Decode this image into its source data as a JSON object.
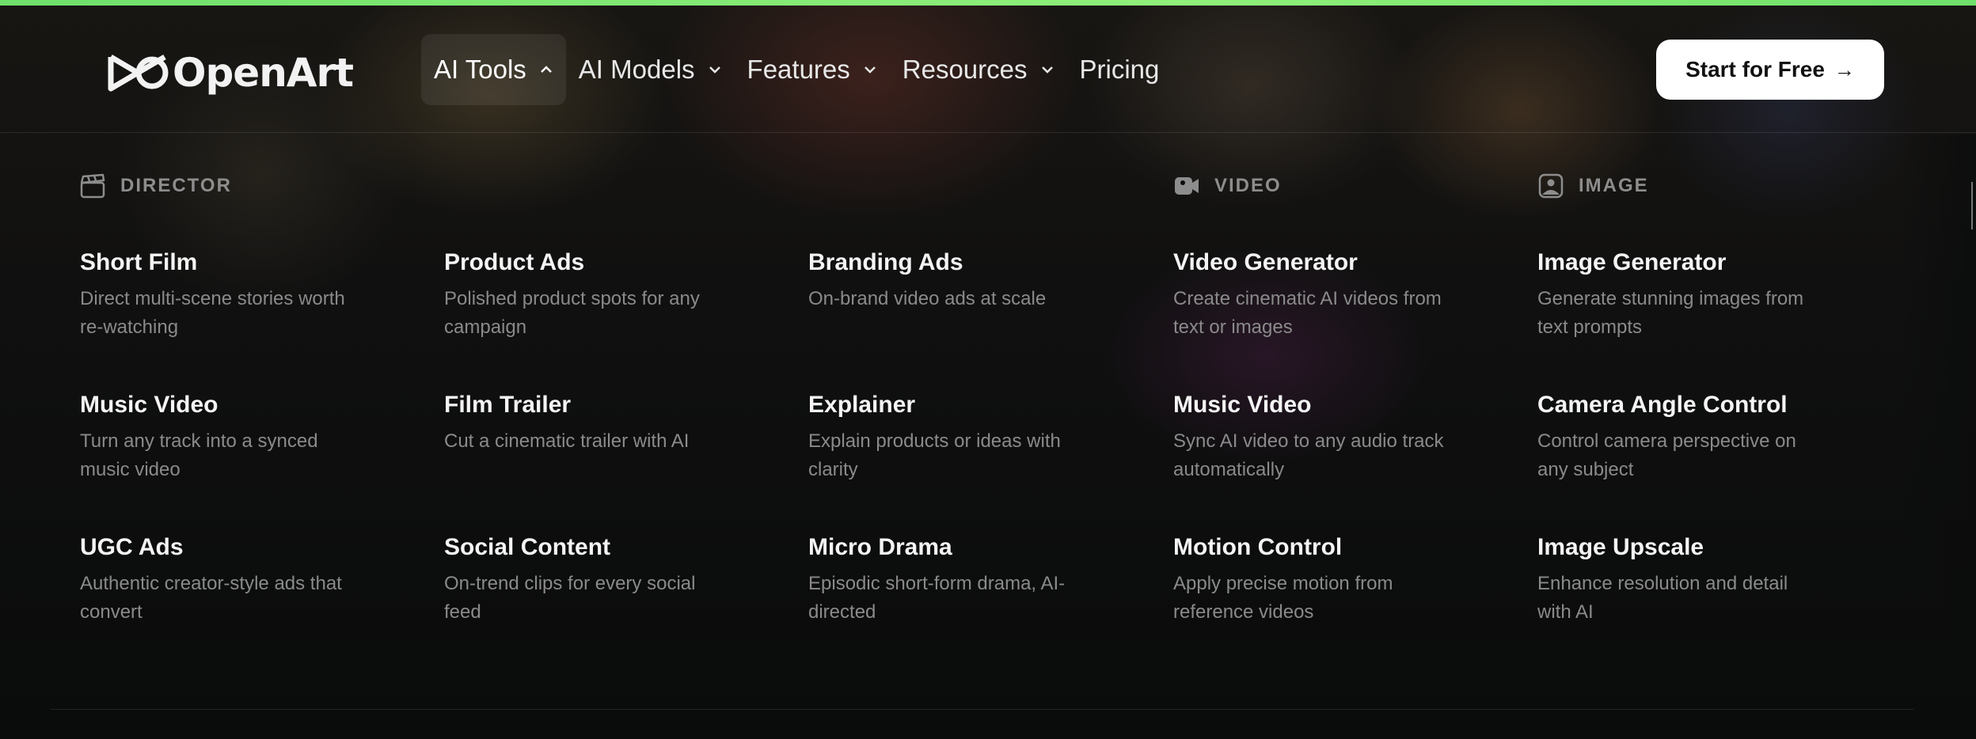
{
  "header": {
    "logo_text": "OpenArt",
    "nav": [
      {
        "label": "AI Tools",
        "active": true,
        "dropdown": true
      },
      {
        "label": "AI Models",
        "dropdown": true
      },
      {
        "label": "Features",
        "dropdown": true
      },
      {
        "label": "Resources",
        "dropdown": true
      },
      {
        "label": "Pricing",
        "dropdown": false
      }
    ],
    "cta_label": "Start for Free"
  },
  "menu": {
    "sections": [
      {
        "label": "DIRECTOR",
        "icon": "clapperboard-icon"
      },
      {
        "label": "VIDEO",
        "icon": "video-camera-icon"
      },
      {
        "label": "IMAGE",
        "icon": "image-icon"
      }
    ],
    "columns": [
      [
        {
          "title": "Short Film",
          "desc": "Direct multi-scene stories worth re-watching"
        },
        {
          "title": "Music Video",
          "desc": "Turn any track into a synced music video"
        },
        {
          "title": "UGC Ads",
          "desc": "Authentic creator-style ads that convert"
        }
      ],
      [
        {
          "title": "Product Ads",
          "desc": "Polished product spots for any campaign"
        },
        {
          "title": "Film Trailer",
          "desc": "Cut a cinematic trailer with AI"
        },
        {
          "title": "Social Content",
          "desc": "On-trend clips for every social feed"
        }
      ],
      [
        {
          "title": "Branding Ads",
          "desc": "On-brand video ads at scale"
        },
        {
          "title": "Explainer",
          "desc": "Explain products or ideas with clarity"
        },
        {
          "title": "Micro Drama",
          "desc": "Episodic short-form drama, AI-directed"
        }
      ],
      [
        {
          "title": "Video Generator",
          "desc": "Create cinematic AI videos from text or images"
        },
        {
          "title": "Music Video",
          "desc": "Sync AI video to any audio track automatically"
        },
        {
          "title": "Motion Control",
          "desc": "Apply precise motion from reference videos"
        }
      ],
      [
        {
          "title": "Image Generator",
          "desc": "Generate stunning images from text prompts"
        },
        {
          "title": "Camera Angle Control",
          "desc": "Control camera perspective on any subject"
        },
        {
          "title": "Image Upscale",
          "desc": "Enhance resolution and detail with AI"
        }
      ]
    ]
  },
  "colors": {
    "accent_bar": "#6fe06a",
    "cta_bg": "#ffffff",
    "muted_text": "#8a8a8a"
  }
}
